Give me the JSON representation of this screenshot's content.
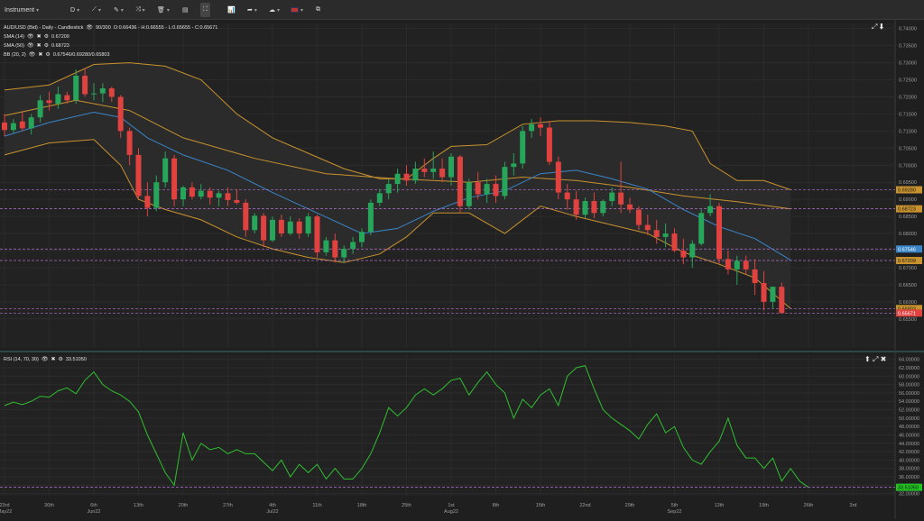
{
  "toolbar": {
    "instrument_label": "Instrument",
    "timeframe_label": "D",
    "icons": [
      "chevron-down-icon",
      "line-tool-icon",
      "pencil-icon",
      "shapes-icon",
      "trash-icon",
      "layout-icon",
      "fit-icon",
      "indicators-icon",
      "share-icon",
      "theme-icon",
      "flag-uk-icon",
      "snapshot-icon"
    ]
  },
  "legends": {
    "main": "AUD/USD (Bid) - Daily - Candlestick",
    "main_counter": "90/300",
    "main_ohlc": "O:0.66436 - H:0.66555 - L:0.65655 - C:0.65671",
    "sma14_label": "SMA (14)",
    "sma14_value": "0.67209",
    "sma50_label": "SMA (50)",
    "sma50_value": "0.68723",
    "bb_label": "BB (20, 2)",
    "bb_value": "0.67546/0.69280/0.65803",
    "rsi_label": "RSI (14, 70, 30)",
    "rsi_value": "33.51050"
  },
  "colors": {
    "bull": "#27a55a",
    "bear": "#e0423f",
    "sma14": "#3a86c8",
    "bb": "#c8922e",
    "rsi": "#2fbf2f",
    "guide": "#b56fd0"
  },
  "chart_data": [
    {
      "type": "candlestick",
      "title": "AUD/USD (Bid) - Daily - Candlestick",
      "ylim": [
        0.6465,
        0.7415
      ],
      "y_ticks": [
        "0.74000",
        "0.73500",
        "0.73000",
        "0.72500",
        "0.72000",
        "0.71500",
        "0.71000",
        "0.70500",
        "0.70000",
        "0.69500",
        "0.69000",
        "0.68500",
        "0.68000",
        "0.67500",
        "0.67000",
        "0.66500",
        "0.66000",
        "0.65500"
      ],
      "x_labels": [
        {
          "label": "23rd",
          "sub": "May22",
          "i": 0
        },
        {
          "label": "30th",
          "i": 5
        },
        {
          "label": "6th",
          "sub": "Jun22",
          "i": 10
        },
        {
          "label": "13th",
          "i": 15
        },
        {
          "label": "20th",
          "i": 20
        },
        {
          "label": "27th",
          "i": 25
        },
        {
          "label": "4th",
          "sub": "Jul22",
          "i": 30
        },
        {
          "label": "11th",
          "i": 35
        },
        {
          "label": "18th",
          "i": 40
        },
        {
          "label": "25th",
          "i": 45
        },
        {
          "label": "1st",
          "sub": "Aug22",
          "i": 50
        },
        {
          "label": "8th",
          "i": 55
        },
        {
          "label": "15th",
          "i": 60
        },
        {
          "label": "22nd",
          "i": 65
        },
        {
          "label": "29th",
          "i": 70
        },
        {
          "label": "5th",
          "sub": "Sep22",
          "i": 75
        },
        {
          "label": "12th",
          "i": 80
        },
        {
          "label": "19th",
          "i": 85
        },
        {
          "label": "26th",
          "i": 90
        },
        {
          "label": "3rd",
          "i": 95
        }
      ],
      "candles": [
        [
          0.7125,
          0.715,
          0.7085,
          0.7103
        ],
        [
          0.7103,
          0.7135,
          0.7095,
          0.7123
        ],
        [
          0.7128,
          0.7155,
          0.71,
          0.7108
        ],
        [
          0.7108,
          0.715,
          0.709,
          0.714
        ],
        [
          0.714,
          0.7205,
          0.7125,
          0.719
        ],
        [
          0.719,
          0.7215,
          0.716,
          0.7182
        ],
        [
          0.718,
          0.723,
          0.7165,
          0.7208
        ],
        [
          0.7205,
          0.7215,
          0.718,
          0.719
        ],
        [
          0.719,
          0.728,
          0.718,
          0.7262
        ],
        [
          0.7262,
          0.7285,
          0.72,
          0.7208
        ],
        [
          0.7208,
          0.724,
          0.719,
          0.721
        ],
        [
          0.721,
          0.724,
          0.7185,
          0.7225
        ],
        [
          0.7225,
          0.723,
          0.7185,
          0.72
        ],
        [
          0.72,
          0.7205,
          0.708,
          0.71
        ],
        [
          0.71,
          0.711,
          0.7,
          0.703
        ],
        [
          0.703,
          0.705,
          0.69,
          0.691
        ],
        [
          0.691,
          0.695,
          0.685,
          0.6875
        ],
        [
          0.6875,
          0.697,
          0.6865,
          0.695
        ],
        [
          0.695,
          0.704,
          0.6935,
          0.702
        ],
        [
          0.702,
          0.703,
          0.688,
          0.69
        ],
        [
          0.69,
          0.694,
          0.688,
          0.6935
        ],
        [
          0.6935,
          0.695,
          0.69,
          0.6908
        ],
        [
          0.6908,
          0.6945,
          0.69,
          0.6925
        ],
        [
          0.6925,
          0.6935,
          0.6885,
          0.6905
        ],
        [
          0.6905,
          0.6925,
          0.688,
          0.6918
        ],
        [
          0.6918,
          0.6935,
          0.688,
          0.6898
        ],
        [
          0.6898,
          0.693,
          0.6885,
          0.689
        ],
        [
          0.689,
          0.69,
          0.679,
          0.681
        ],
        [
          0.681,
          0.686,
          0.68,
          0.6852
        ],
        [
          0.6852,
          0.686,
          0.676,
          0.678
        ],
        [
          0.678,
          0.685,
          0.6775,
          0.684
        ],
        [
          0.684,
          0.6855,
          0.679,
          0.68
        ],
        [
          0.68,
          0.685,
          0.6795,
          0.6835
        ],
        [
          0.6835,
          0.6845,
          0.6785,
          0.68
        ],
        [
          0.68,
          0.686,
          0.679,
          0.685
        ],
        [
          0.685,
          0.6855,
          0.673,
          0.6745
        ],
        [
          0.6745,
          0.679,
          0.6735,
          0.678
        ],
        [
          0.678,
          0.68,
          0.6715,
          0.673
        ],
        [
          0.673,
          0.6765,
          0.6715,
          0.6755
        ],
        [
          0.6755,
          0.679,
          0.674,
          0.6775
        ],
        [
          0.6775,
          0.6815,
          0.676,
          0.6805
        ],
        [
          0.6805,
          0.69,
          0.6795,
          0.689
        ],
        [
          0.689,
          0.693,
          0.688,
          0.6918
        ],
        [
          0.6918,
          0.696,
          0.69,
          0.6945
        ],
        [
          0.6945,
          0.699,
          0.692,
          0.6975
        ],
        [
          0.6975,
          0.7,
          0.694,
          0.6955
        ],
        [
          0.6955,
          0.701,
          0.6945,
          0.699
        ],
        [
          0.699,
          0.702,
          0.6965,
          0.698
        ],
        [
          0.698,
          0.704,
          0.696,
          0.699
        ],
        [
          0.699,
          0.702,
          0.695,
          0.6965
        ],
        [
          0.6965,
          0.7035,
          0.694,
          0.7025
        ],
        [
          0.7025,
          0.703,
          0.686,
          0.688
        ],
        [
          0.688,
          0.696,
          0.687,
          0.695
        ],
        [
          0.695,
          0.698,
          0.69,
          0.6915
        ],
        [
          0.6915,
          0.696,
          0.689,
          0.6945
        ],
        [
          0.6945,
          0.697,
          0.689,
          0.691
        ],
        [
          0.691,
          0.701,
          0.69,
          0.6995
        ],
        [
          0.6995,
          0.7035,
          0.697,
          0.7005
        ],
        [
          0.7005,
          0.7115,
          0.699,
          0.71
        ],
        [
          0.71,
          0.7135,
          0.708,
          0.712
        ],
        [
          0.712,
          0.714,
          0.7085,
          0.711
        ],
        [
          0.711,
          0.713,
          0.7,
          0.701
        ],
        [
          0.701,
          0.7025,
          0.69,
          0.692
        ],
        [
          0.692,
          0.6945,
          0.687,
          0.69
        ],
        [
          0.69,
          0.6925,
          0.684,
          0.6855
        ],
        [
          0.6855,
          0.6905,
          0.6845,
          0.6895
        ],
        [
          0.6895,
          0.692,
          0.6845,
          0.686
        ],
        [
          0.686,
          0.69,
          0.685,
          0.6895
        ],
        [
          0.6895,
          0.6935,
          0.688,
          0.692
        ],
        [
          0.692,
          0.701,
          0.686,
          0.6885
        ],
        [
          0.6885,
          0.6905,
          0.686,
          0.687
        ],
        [
          0.687,
          0.688,
          0.681,
          0.6825
        ],
        [
          0.6825,
          0.6855,
          0.6795,
          0.681
        ],
        [
          0.681,
          0.684,
          0.677,
          0.679
        ],
        [
          0.679,
          0.683,
          0.676,
          0.68
        ],
        [
          0.68,
          0.6815,
          0.6745,
          0.675
        ],
        [
          0.675,
          0.6785,
          0.671,
          0.673
        ],
        [
          0.673,
          0.678,
          0.67,
          0.677
        ],
        [
          0.677,
          0.687,
          0.6765,
          0.686
        ],
        [
          0.686,
          0.6915,
          0.685,
          0.688
        ],
        [
          0.688,
          0.689,
          0.671,
          0.6725
        ],
        [
          0.6725,
          0.675,
          0.668,
          0.6695
        ],
        [
          0.6695,
          0.6735,
          0.665,
          0.672
        ],
        [
          0.672,
          0.6735,
          0.668,
          0.6695
        ],
        [
          0.6695,
          0.6725,
          0.662,
          0.6655
        ],
        [
          0.6655,
          0.669,
          0.6575,
          0.66
        ],
        [
          0.66,
          0.6645,
          0.658,
          0.6644
        ],
        [
          0.6644,
          0.6656,
          0.6566,
          0.6567
        ]
      ],
      "sma14": [
        [
          0,
          0.7085
        ],
        [
          5,
          0.7125
        ],
        [
          10,
          0.7155
        ],
        [
          13,
          0.714
        ],
        [
          16,
          0.708
        ],
        [
          20,
          0.703
        ],
        [
          25,
          0.6985
        ],
        [
          30,
          0.692
        ],
        [
          35,
          0.686
        ],
        [
          40,
          0.68
        ],
        [
          44,
          0.6815
        ],
        [
          48,
          0.6865
        ],
        [
          52,
          0.6905
        ],
        [
          56,
          0.6925
        ],
        [
          60,
          0.6975
        ],
        [
          64,
          0.6985
        ],
        [
          68,
          0.696
        ],
        [
          72,
          0.693
        ],
        [
          76,
          0.687
        ],
        [
          80,
          0.682
        ],
        [
          84,
          0.6785
        ],
        [
          88,
          0.6722
        ]
      ],
      "sma50": [
        [
          0,
          0.7145
        ],
        [
          8,
          0.719
        ],
        [
          14,
          0.716
        ],
        [
          20,
          0.708
        ],
        [
          28,
          0.702
        ],
        [
          36,
          0.6975
        ],
        [
          44,
          0.696
        ],
        [
          52,
          0.695
        ],
        [
          58,
          0.6965
        ],
        [
          64,
          0.6955
        ],
        [
          70,
          0.6935
        ],
        [
          76,
          0.691
        ],
        [
          82,
          0.6893
        ],
        [
          88,
          0.6872
        ]
      ],
      "bb_upper": [
        [
          0,
          0.722
        ],
        [
          5,
          0.7235
        ],
        [
          10,
          0.7295
        ],
        [
          14,
          0.73
        ],
        [
          18,
          0.729
        ],
        [
          22,
          0.725
        ],
        [
          26,
          0.715
        ],
        [
          30,
          0.708
        ],
        [
          34,
          0.7035
        ],
        [
          38,
          0.699
        ],
        [
          42,
          0.696
        ],
        [
          45,
          0.696
        ],
        [
          48,
          0.702
        ],
        [
          50,
          0.7055
        ],
        [
          54,
          0.706
        ],
        [
          58,
          0.712
        ],
        [
          62,
          0.713
        ],
        [
          66,
          0.713
        ],
        [
          70,
          0.7125
        ],
        [
          74,
          0.7115
        ],
        [
          77,
          0.71
        ],
        [
          79,
          0.7005
        ],
        [
          82,
          0.6955
        ],
        [
          85,
          0.6955
        ],
        [
          88,
          0.6928
        ]
      ],
      "bb_lower": [
        [
          0,
          0.703
        ],
        [
          5,
          0.7065
        ],
        [
          10,
          0.7075
        ],
        [
          13,
          0.7
        ],
        [
          15,
          0.69
        ],
        [
          18,
          0.687
        ],
        [
          22,
          0.684
        ],
        [
          26,
          0.679
        ],
        [
          30,
          0.6755
        ],
        [
          34,
          0.673
        ],
        [
          38,
          0.6715
        ],
        [
          42,
          0.674
        ],
        [
          45,
          0.679
        ],
        [
          48,
          0.686
        ],
        [
          52,
          0.686
        ],
        [
          56,
          0.68
        ],
        [
          60,
          0.688
        ],
        [
          64,
          0.685
        ],
        [
          68,
          0.6825
        ],
        [
          72,
          0.68
        ],
        [
          76,
          0.6745
        ],
        [
          80,
          0.671
        ],
        [
          84,
          0.667
        ],
        [
          88,
          0.658
        ]
      ],
      "price_markers": [
        {
          "label": "0.69280",
          "price": 0.6928,
          "color": "#c8922e"
        },
        {
          "label": "0.68723",
          "price": 0.68723,
          "color": "#c8922e"
        },
        {
          "label": "0.67546",
          "price": 0.67546,
          "color": "#3a86c8"
        },
        {
          "label": "0.67209",
          "price": 0.67209,
          "color": "#c8922e"
        },
        {
          "label": "0.65803",
          "price": 0.65803,
          "color": "#c8922e"
        },
        {
          "label": "0.65671",
          "price": 0.65671,
          "color": "#e0423f"
        }
      ]
    },
    {
      "type": "line",
      "title": "RSI (14, 70, 30)",
      "ylim": [
        31.5,
        65
      ],
      "y_ticks": [
        "64.00000",
        "62.00000",
        "60.00000",
        "58.00000",
        "56.00000",
        "54.00000",
        "52.00000",
        "50.00000",
        "48.00000",
        "46.00000",
        "44.00000",
        "42.00000",
        "40.00000",
        "38.00000",
        "36.00000",
        "34.00000",
        "32.00000"
      ],
      "guide_level": 33.5105,
      "last_label": "33.51050",
      "values": [
        53.0,
        53.8,
        53.2,
        54.0,
        55.2,
        55.0,
        56.5,
        57.2,
        55.8,
        59.0,
        61.0,
        58.0,
        56.5,
        55.5,
        54.0,
        51.5,
        46.0,
        41.5,
        37.0,
        34.0,
        46.5,
        40.0,
        44.0,
        42.5,
        43.0,
        41.5,
        42.5,
        41.5,
        41.5,
        39.5,
        37.5,
        40.0,
        36.0,
        39.0,
        37.0,
        39.0,
        35.5,
        38.0,
        35.5,
        35.5,
        38.0,
        41.5,
        46.5,
        52.5,
        50.5,
        52.5,
        55.5,
        57.0,
        55.5,
        57.0,
        59.0,
        59.5,
        55.5,
        58.5,
        61.0,
        58.0,
        56.0,
        50.0,
        54.5,
        52.5,
        55.5,
        57.0,
        53.0,
        60.0,
        62.0,
        62.5,
        57.0,
        52.0,
        50.0,
        48.5,
        47.0,
        45.0,
        48.5,
        51.0,
        46.5,
        48.0,
        43.0,
        40.0,
        39.0,
        42.0,
        44.5,
        50.0,
        43.5,
        40.5,
        40.5,
        38.0,
        40.5,
        35.0,
        38.0,
        35.0,
        33.5
      ]
    }
  ]
}
